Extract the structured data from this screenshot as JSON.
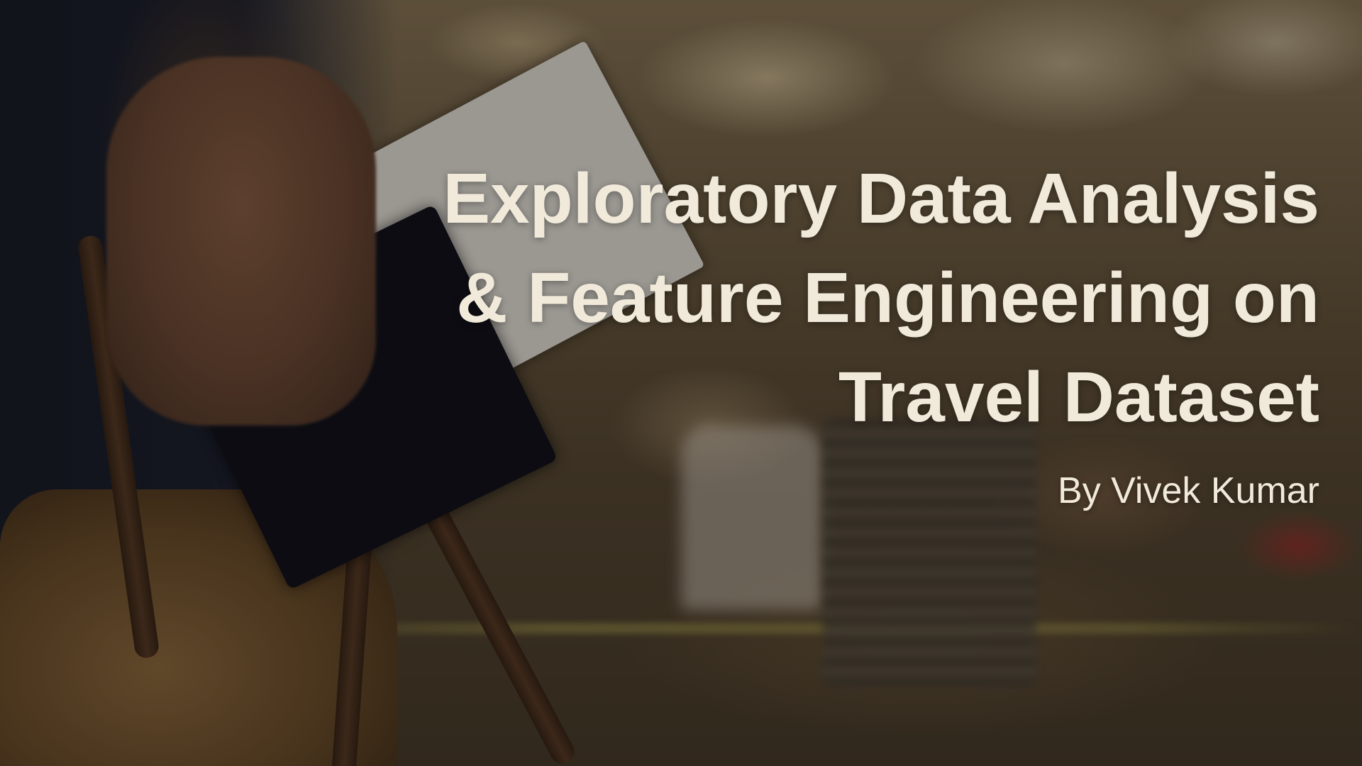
{
  "slide": {
    "title_lines": [
      "Exploratory Data Analysis",
      "& Feature Engineering on",
      "Travel Dataset"
    ],
    "byline": "By Vivek Kumar",
    "colors": {
      "text": "#f1eadb",
      "overlay": "rgba(0,0,0,0.33)"
    },
    "background_image": "airport-traveler-boarding-pass-photo"
  }
}
